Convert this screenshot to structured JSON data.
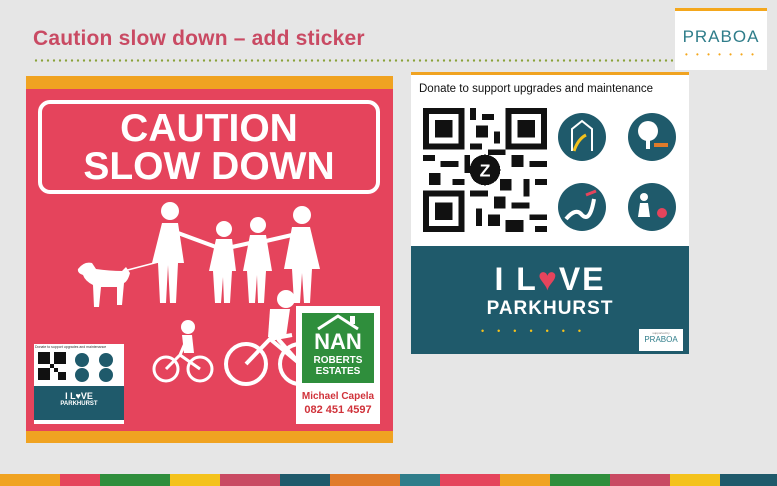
{
  "slide": {
    "title": "Caution slow down – add sticker",
    "logo": "PRABOA",
    "logo_dots": "• • • • • • •"
  },
  "poster": {
    "line1": "CAUTION",
    "line2": "SLOW DOWN",
    "sponsor": {
      "name": "NAN",
      "sub1": "ROBERTS",
      "sub2": "ESTATES",
      "person": "Michael Capela",
      "phone": "082 451 4597"
    },
    "mini_sticker": {
      "caption": "Donate to support upgrades and maintenance",
      "love": "I L♥VE",
      "place": "PARKHURST"
    }
  },
  "sticker": {
    "caption": "Donate to support upgrades and maintenance",
    "love_i": "I L",
    "love_heart": "♥",
    "love_ve": "VE",
    "place": "PARKHURST",
    "dots": "•••••••",
    "small_logo_sub": "supported by",
    "small_logo": "PRABOA"
  },
  "colors": {
    "title": "#c94a63",
    "poster_red": "#e5445c",
    "accent_orange": "#f0a321",
    "teal": "#1f5a6b",
    "green": "#2f8e3c"
  }
}
